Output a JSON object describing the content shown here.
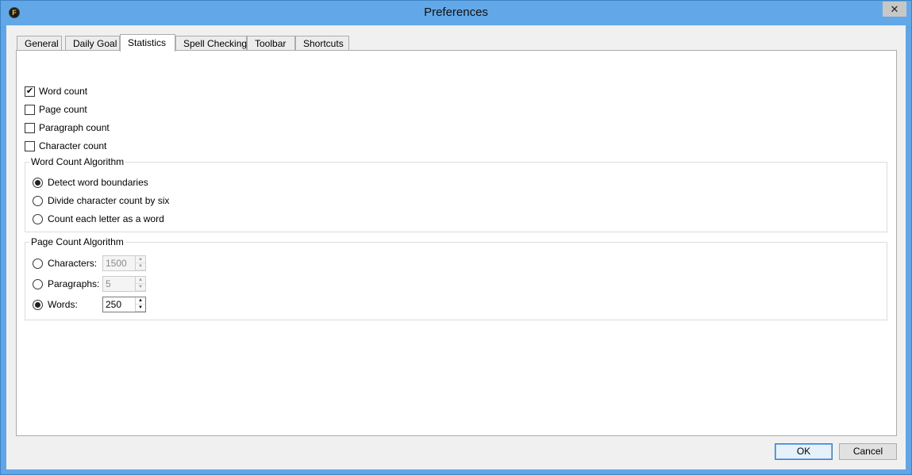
{
  "window": {
    "title": "Preferences",
    "app_icon_letter": "F",
    "close_glyph": "✕"
  },
  "tabs": [
    {
      "label": "General",
      "active": false
    },
    {
      "label": "Daily Goal",
      "active": false
    },
    {
      "label": "Statistics",
      "active": true
    },
    {
      "label": "Spell Checking",
      "active": false
    },
    {
      "label": "Toolbar",
      "active": false
    },
    {
      "label": "Shortcuts",
      "active": false
    }
  ],
  "statistics": {
    "checkboxes": [
      {
        "label": "Word count",
        "checked": true
      },
      {
        "label": "Page count",
        "checked": false
      },
      {
        "label": "Paragraph count",
        "checked": false
      },
      {
        "label": "Character count",
        "checked": false
      }
    ],
    "word_count_algorithm": {
      "title": "Word Count Algorithm",
      "options": [
        {
          "label": "Detect word boundaries",
          "selected": true
        },
        {
          "label": "Divide character count by six",
          "selected": false
        },
        {
          "label": "Count each letter as a word",
          "selected": false
        }
      ]
    },
    "page_count_algorithm": {
      "title": "Page Count Algorithm",
      "options": [
        {
          "label": "Characters:",
          "selected": false,
          "value": "1500",
          "enabled": false
        },
        {
          "label": "Paragraphs:",
          "selected": false,
          "value": "5",
          "enabled": false
        },
        {
          "label": "Words:",
          "selected": true,
          "value": "250",
          "enabled": true
        }
      ]
    }
  },
  "buttons": {
    "ok": "OK",
    "cancel": "Cancel"
  },
  "icons": {
    "check": "✔",
    "spin_up": "▲",
    "spin_down": "▼"
  },
  "colors": {
    "titlebar": "#62a8e8",
    "client_bg": "#f0f0f0",
    "panel_bg": "#ffffff"
  }
}
